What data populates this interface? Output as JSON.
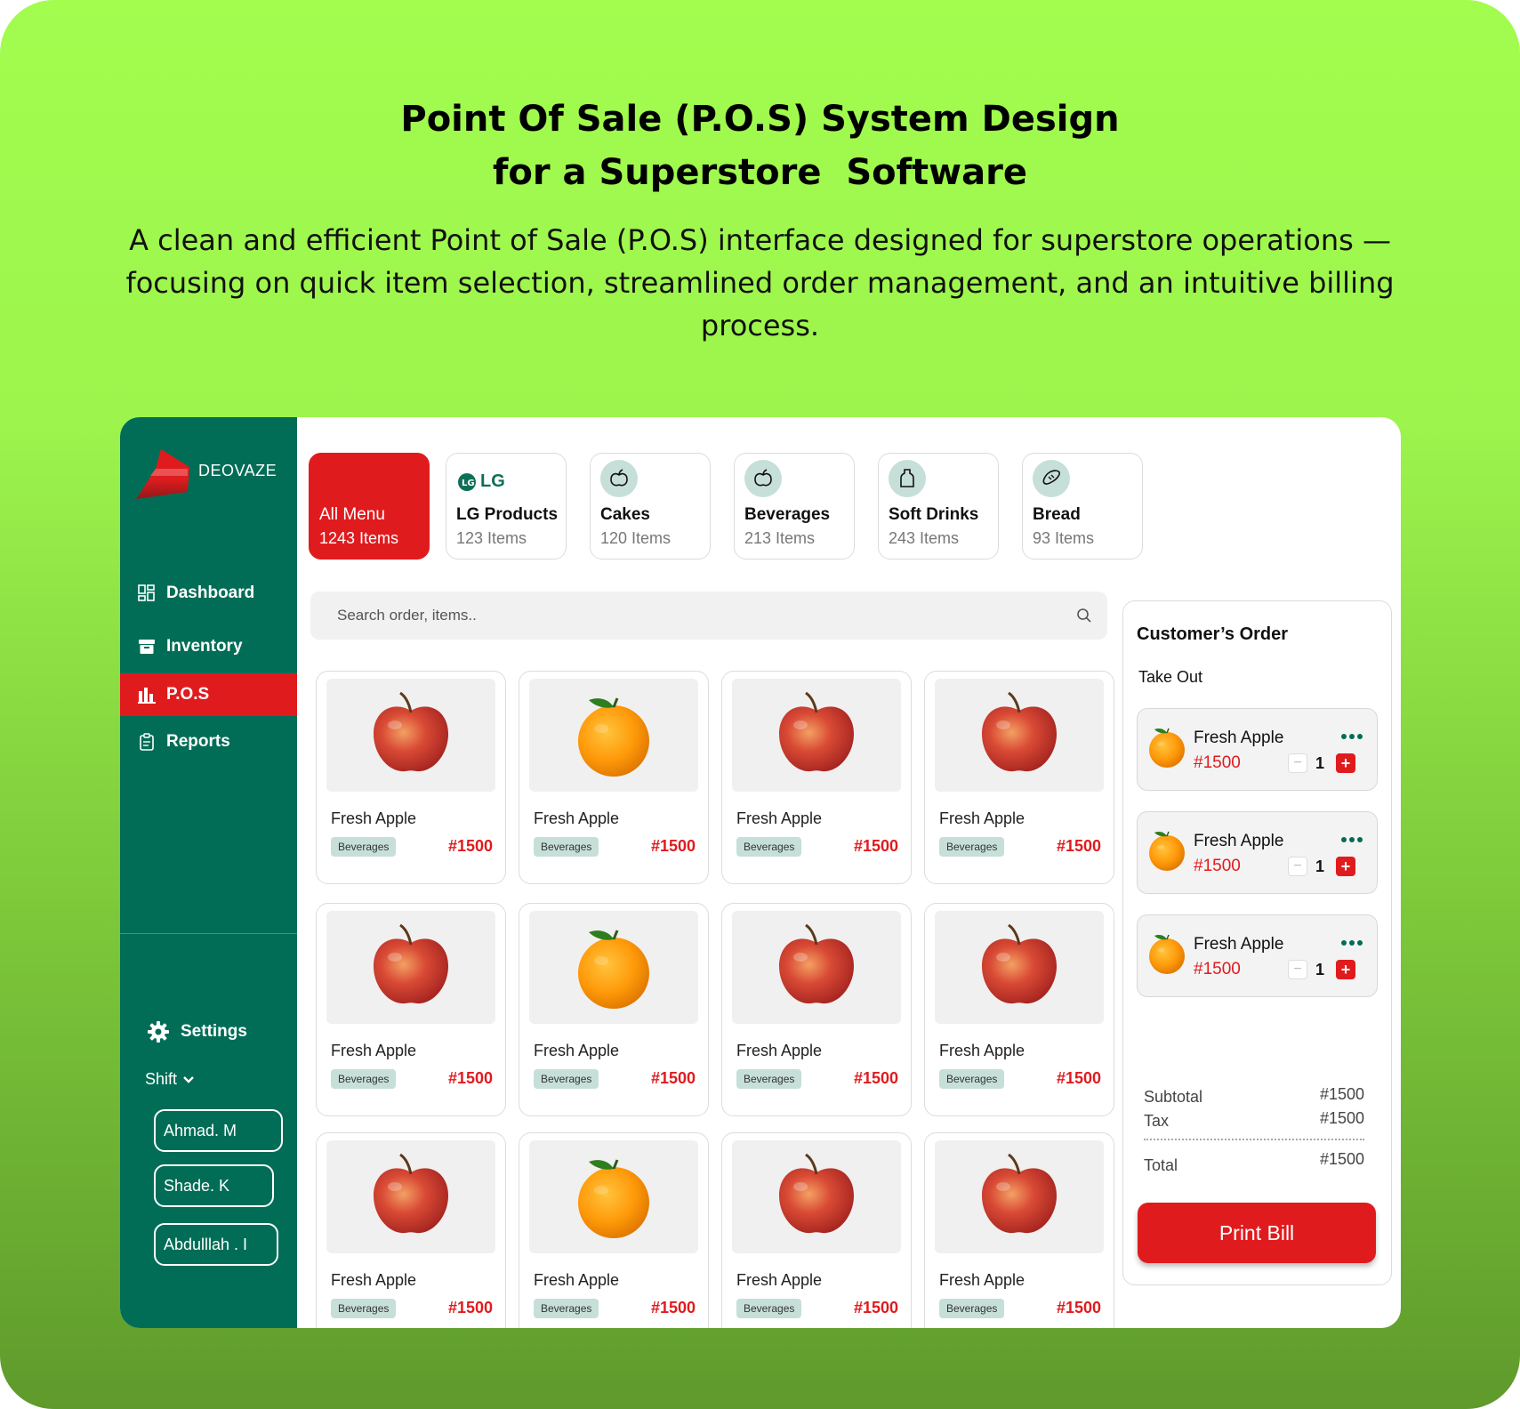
{
  "header": {
    "title_line1": "Point Of Sale (P.O.S) System Design",
    "title_line2": "for a Superstore  Software",
    "description": "A clean and efficient Point of Sale (P.O.S) interface designed for superstore operations — focusing on quick item selection, streamlined order management, and an intuitive billing process."
  },
  "sidebar": {
    "brand": "DEOVAZE",
    "nav": [
      {
        "label": "Dashboard",
        "icon": "dashboard-icon"
      },
      {
        "label": "Inventory",
        "icon": "archive-icon"
      },
      {
        "label": "P.O.S",
        "icon": "bar-chart-icon",
        "active": true
      },
      {
        "label": "Reports",
        "icon": "clipboard-icon"
      }
    ],
    "settings_label": "Settings",
    "shift_label": "Shift",
    "staff": [
      "Ahmad. M",
      "Shade. K",
      "Abdulllah . I"
    ]
  },
  "categories": [
    {
      "name": "All Menu",
      "count": "1243 Items",
      "active": true
    },
    {
      "name": "LG Products",
      "count": "123 Items",
      "icon": "lg-logo",
      "logo_text": "LG"
    },
    {
      "name": "Cakes",
      "count": "120 Items",
      "icon": "apple-icon"
    },
    {
      "name": "Beverages",
      "count": "213 Items",
      "icon": "apple-icon"
    },
    {
      "name": "Soft Drinks",
      "count": "243 Items",
      "icon": "bottle-icon"
    },
    {
      "name": "Bread",
      "count": "93 Items",
      "icon": "bread-icon"
    }
  ],
  "search": {
    "placeholder": "Search order, items.."
  },
  "products": [
    {
      "name": "Fresh Apple",
      "tag": "Beverages",
      "price": "#1500",
      "image": "apple"
    },
    {
      "name": "Fresh Apple",
      "tag": "Beverages",
      "price": "#1500",
      "image": "orange"
    },
    {
      "name": "Fresh Apple",
      "tag": "Beverages",
      "price": "#1500",
      "image": "apple"
    },
    {
      "name": "Fresh Apple",
      "tag": "Beverages",
      "price": "#1500",
      "image": "apple"
    },
    {
      "name": "Fresh Apple",
      "tag": "Beverages",
      "price": "#1500",
      "image": "apple"
    },
    {
      "name": "Fresh Apple",
      "tag": "Beverages",
      "price": "#1500",
      "image": "orange"
    },
    {
      "name": "Fresh Apple",
      "tag": "Beverages",
      "price": "#1500",
      "image": "apple"
    },
    {
      "name": "Fresh Apple",
      "tag": "Beverages",
      "price": "#1500",
      "image": "apple"
    },
    {
      "name": "Fresh Apple",
      "tag": "Beverages",
      "price": "#1500",
      "image": "apple"
    },
    {
      "name": "Fresh Apple",
      "tag": "Beverages",
      "price": "#1500",
      "image": "orange"
    },
    {
      "name": "Fresh Apple",
      "tag": "Beverages",
      "price": "#1500",
      "image": "apple"
    },
    {
      "name": "Fresh Apple",
      "tag": "Beverages",
      "price": "#1500",
      "image": "apple"
    }
  ],
  "order": {
    "title": "Customer’s Order",
    "type": "Take Out",
    "items": [
      {
        "name": "Fresh Apple",
        "price": "#1500",
        "qty": "1"
      },
      {
        "name": "Fresh Apple",
        "price": "#1500",
        "qty": "1"
      },
      {
        "name": "Fresh Apple",
        "price": "#1500",
        "qty": "1"
      }
    ],
    "subtotal_label": "Subtotal",
    "subtotal": "#1500",
    "tax_label": "Tax",
    "tax": "#1500",
    "total_label": "Total",
    "total": "#1500",
    "print_label": "Print Bill"
  },
  "colors": {
    "primary_green": "#016d56",
    "accent_red": "#e01b1e",
    "background_lime": "#a2fd4f"
  }
}
